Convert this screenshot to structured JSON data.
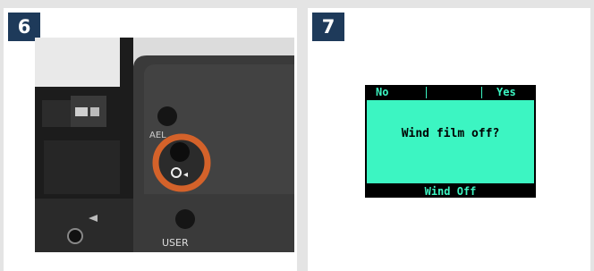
{
  "step6": {
    "number": "6",
    "photo_labels": {
      "ael": "AEL",
      "user": "USER"
    }
  },
  "step7": {
    "number": "7",
    "lcd": {
      "softkeys": {
        "left": "No",
        "right": "Yes"
      },
      "message": "Wind film off?",
      "bottom_label": "Wind Off",
      "screen_color": "#3cf5c2"
    }
  },
  "colors": {
    "badge": "#1e3a5a",
    "highlight_ring": "#d4622a"
  }
}
